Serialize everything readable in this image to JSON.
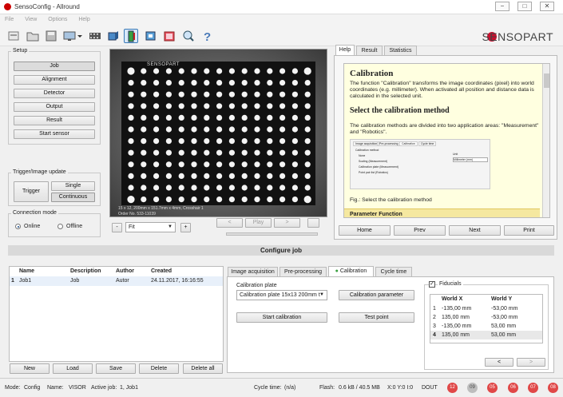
{
  "window": {
    "title": "SensoConfig - Allround",
    "minimize": "−",
    "maximize": "□",
    "close": "✕"
  },
  "menu": [
    "File",
    "View",
    "Options",
    "Help"
  ],
  "brand": {
    "logo_text": "SENSOPART",
    "accent": "#c8102e"
  },
  "toolbar_icons": [
    "open-icon",
    "folder-icon",
    "save-icon",
    "monitor-icon",
    "dropdown-icon",
    "film-icon",
    "camera-3d-icon",
    "sensor-active-icon",
    "settings-icon",
    "chart-icon",
    "search-icon",
    "help-icon"
  ],
  "setup": {
    "label": "Setup",
    "buttons": [
      "Job",
      "Alignment",
      "Detector",
      "Output",
      "Result",
      "Start sensor"
    ],
    "active": "Job"
  },
  "trigger": {
    "label": "Trigger/Image update",
    "trigger": "Trigger",
    "single": "Single",
    "continuous": "Continuous"
  },
  "connection": {
    "label": "Connection mode",
    "online": "Online",
    "offline": "Offline",
    "selected": "Online"
  },
  "image": {
    "brand_text": "SENSOPART",
    "caption_line1": "15 x 12, 200mm x 151.7mm x 4mm, Crosshair 1",
    "caption_line2": "Order No. 533-11039"
  },
  "image_controls": {
    "zoom_out": "-",
    "zoom": "Fit",
    "zoom_in": "+",
    "prev": "<",
    "play": "Play",
    "next": ">"
  },
  "help_tabs": [
    "Help",
    "Result",
    "Statistics"
  ],
  "help": {
    "title": "Calibration",
    "intro": "The function \"Calibration\" transforms the image coordinates (pixel) into world coordinates (e.g. millimeter). When activated all position and distance data is calculated in the selected unit.",
    "h2": "Select the calibration method",
    "p2": "The calibration methods are divided into two application areas: \"Measurement\" and \"Robotics\".",
    "fig_caption": "Fig.: Select the calibration method",
    "next_section": "Parameter Function",
    "fig": {
      "tabs": [
        "Image acquisition",
        "Pre-processing",
        "Calibration",
        "Cycle time"
      ],
      "method_label": "Calibration method",
      "options": [
        "None",
        "Scaling (Measurement)",
        "Calibration plate (Measurement)",
        "Point pair list (Robotics)"
      ],
      "unit_label": "Unit",
      "unit_value": "Millimeter (mm)"
    }
  },
  "help_nav": [
    "Home",
    "Prev",
    "Next",
    "Print"
  ],
  "configure": {
    "title": "Configure job",
    "columns": [
      "Name",
      "Description",
      "Author",
      "Created"
    ],
    "rows": [
      {
        "index": "1",
        "name": "Job1",
        "description": "Job",
        "author": "Autor",
        "created": "24.11.2017, 16:16:55"
      }
    ],
    "buttons": [
      "New",
      "Load",
      "Save",
      "Delete",
      "Delete all"
    ]
  },
  "config_tabs": [
    "Image acquisition",
    "Pre-processing",
    "Calibration",
    "Cycle time"
  ],
  "calibration": {
    "plate_label": "Calibration plate",
    "plate_value": "Calibration plate 15x13 200mm t",
    "parameter": "Calibration parameter",
    "start": "Start calibration",
    "test": "Test point"
  },
  "fiducials": {
    "label": "Fiducials",
    "columns": [
      "World X",
      "World Y"
    ],
    "rows": [
      {
        "index": "1",
        "x": "-135,00 mm",
        "y": "-53,00 mm"
      },
      {
        "index": "2",
        "x": "135,00 mm",
        "y": "-53,00 mm"
      },
      {
        "index": "3",
        "x": "-135,00 mm",
        "y": "53,00 mm"
      },
      {
        "index": "4",
        "x": "135,00 mm",
        "y": "53,00 mm"
      }
    ],
    "prev": "<",
    "next": ">"
  },
  "status": {
    "mode": "Mode:",
    "mode_value": "Config",
    "name": "Name:",
    "name_value": "VISOR",
    "active_job": "Active job:",
    "active_job_value": "1, Job1",
    "cycle": "Cycle time:",
    "cycle_value": "(n/a)",
    "flash": "Flash:",
    "flash_value": "0.6 kB / 40.5 MB",
    "coords": "X:0 Y:0 I:0",
    "dout": "DOUT",
    "io": [
      {
        "label": "12",
        "on": true
      },
      {
        "label": "09",
        "on": false
      },
      {
        "label": "05",
        "on": true
      },
      {
        "label": "06",
        "on": true
      },
      {
        "label": "07",
        "on": true
      },
      {
        "label": "08",
        "on": true
      }
    ]
  }
}
